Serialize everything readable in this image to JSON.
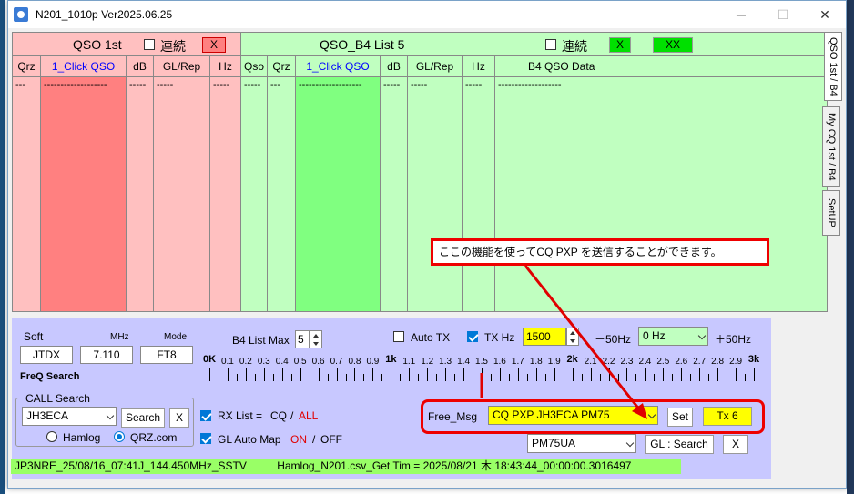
{
  "window": {
    "title": "N201_1010p   Ver2025.06.25",
    "minimize": "─",
    "maximize": "☐",
    "close": "✕"
  },
  "qso1st": {
    "title": "QSO  1st",
    "renzoku_label": "連続",
    "x_button": "X",
    "columns": [
      "Qrz",
      "1_Click QSO",
      "dB",
      "GL/Rep",
      "Hz"
    ],
    "rows": [
      [
        "---",
        "-------------------",
        "-----",
        "-----",
        "-----"
      ]
    ]
  },
  "qsoB4": {
    "title": "QSO_B4   List  5",
    "renzoku_label": "連続",
    "x_button": "X",
    "xx_button": "XX",
    "columns": [
      "Qso",
      "Qrz",
      "1_Click QSO",
      "dB",
      "GL/Rep",
      "Hz",
      "B4 QSO Data"
    ],
    "rows": [
      [
        "-----",
        "---",
        "-------------------",
        "-----",
        "-----",
        "-----",
        "-------------------"
      ]
    ]
  },
  "tabs": [
    "QSO 1st / B4",
    "My CQ 1st / B4",
    "SetUP"
  ],
  "callout": "ここの機能を使ってCQ PXP を送信することができます。",
  "soft": {
    "label": "Soft",
    "value": "JTDX"
  },
  "mhz": {
    "label": "MHz",
    "value": "7.110"
  },
  "mode": {
    "label": "Mode",
    "value": "FT8"
  },
  "freq_search": "FreQ Search",
  "b4_list_max": {
    "label": "B4 List Max",
    "value": "5"
  },
  "auto_tx": {
    "label": "Auto TX",
    "checked": false
  },
  "tx_hz": {
    "label": "TX Hz",
    "checked": true,
    "value": "1500"
  },
  "minus50": "－50Hz",
  "offset": {
    "value": "0 Hz"
  },
  "plus50": "＋50Hz",
  "scale": [
    "0K",
    "0.1",
    "0.2",
    "0.3",
    "0.4",
    "0.5",
    "0.6",
    "0.7",
    "0.8",
    "0.9",
    "1k",
    "1.1",
    "1.2",
    "1.3",
    "1.4",
    "1.5",
    "1.6",
    "1.7",
    "1.8",
    "1.9",
    "2k",
    "2.1",
    "2.2",
    "2.3",
    "2.4",
    "2.5",
    "2.6",
    "2.7",
    "2.8",
    "2.9",
    "3k"
  ],
  "call_search": {
    "label": "CALL Search",
    "value": "JH3ECA",
    "search_button": "Search",
    "x_button": "X"
  },
  "radio": {
    "hamlog": "Hamlog",
    "qrz": "QRZ.com",
    "selected": "qrz"
  },
  "rx_list": {
    "label": "RX List =",
    "cq": "CQ",
    "slash": "/",
    "all": "ALL",
    "checked": true
  },
  "gl_auto_map": {
    "label": "GL Auto Map",
    "on": "ON",
    "slash": "/",
    "off": "OFF",
    "checked": true
  },
  "free_msg": {
    "label": "Free_Msg",
    "value": "CQ PXP JH3ECA PM75",
    "set_button": "Set",
    "tx_button": "Tx 6"
  },
  "gl_search": {
    "value": "PM75UA",
    "button": "GL : Search",
    "x_button": "X"
  },
  "status": {
    "left": "JP3NRE_25/08/16_07:41J_144.450MHz_SSTV",
    "right": "Hamlog_N201.csv_Get Tim = 2025/08/21 木 18:43:44_00:00:00.3016497"
  },
  "colors": {
    "pink": "#ffc0c0",
    "pink_dark": "#ff8080",
    "green": "#c0ffc0",
    "green_dark": "#80ff80",
    "control_bg": "#c8c8ff",
    "highlight": "#ffff00",
    "callout_red": "#e00000"
  }
}
